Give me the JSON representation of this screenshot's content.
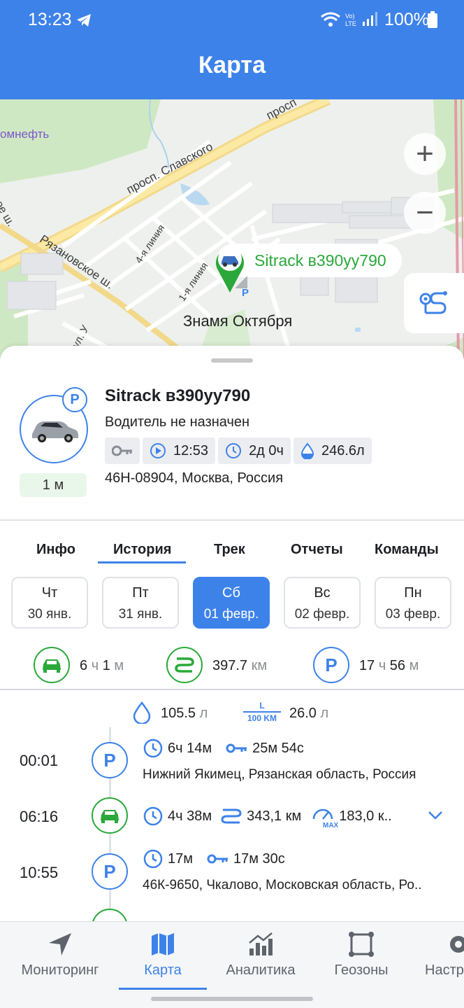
{
  "status_bar": {
    "time": "13:23",
    "battery": "100%"
  },
  "app_title": "Карта",
  "map": {
    "labels": {
      "company": "омнефть",
      "avenue": "просп. Славского",
      "avenue_top": "просп",
      "road_left": "овское ш.",
      "road_ryazan": "Рязановское ш.",
      "line4": "4-я линия",
      "line1": "1-я линия",
      "street": "ул. У",
      "town": "Знамя Октября"
    },
    "zoom_in": "+",
    "zoom_out": "−",
    "vehicle_pin_label": "Sitrack в390уу790",
    "parking_mark": "P"
  },
  "vehicle": {
    "title": "Sitrack в390уу790",
    "driver": "Водитель не назначен",
    "status_badge": "P",
    "duration": "1 м",
    "chips": {
      "ignition_time": "12:53",
      "idle_time": "2д 0ч",
      "fuel": "246.6л"
    },
    "address": "46Н-08904, Москва, Россия"
  },
  "tabs": [
    "Инфо",
    "История",
    "Трек",
    "Отчеты",
    "Команды"
  ],
  "days": [
    {
      "dow": "Чт",
      "date": "30 янв."
    },
    {
      "dow": "Пт",
      "date": "31 янв."
    },
    {
      "dow": "Сб",
      "date": "01 февр."
    },
    {
      "dow": "Вс",
      "date": "02 февр."
    },
    {
      "dow": "Пн",
      "date": "03 февр."
    }
  ],
  "summary": {
    "drive_h": "6",
    "drive_h_unit": "ч",
    "drive_m": "1",
    "drive_m_unit": "м",
    "distance": "397.7",
    "distance_unit": "км",
    "park_h": "17",
    "park_h_unit": "ч",
    "park_m": "56",
    "park_m_unit": "м",
    "fuel_used": "105.5",
    "fuel_unit": "л",
    "consumption_top": "L",
    "consumption_bottom": "100 KM",
    "consumption": "26.0",
    "consumption_unit": "л"
  },
  "events": [
    {
      "time": "00:01",
      "type": "P",
      "duration": "6ч 14м",
      "ignition": "25м 54с",
      "address": "Нижний Якимец, Рязанская область, Россия"
    },
    {
      "time": "06:16",
      "type": "drive",
      "duration": "4ч 38м",
      "distance": "343,1 км",
      "max_speed": "183,0 к..",
      "max_label": "MAX"
    },
    {
      "time": "10:55",
      "type": "P",
      "duration": "17м",
      "ignition": "17м 30с",
      "address": "46К-9650, Чкалово, Московская область, Ро.."
    }
  ],
  "nav": [
    "Мониторинг",
    "Карта",
    "Аналитика",
    "Геозоны",
    "Настр"
  ],
  "colors": {
    "primary": "#3d82e9",
    "green": "#2aa83a",
    "park": "#3d82e9"
  }
}
